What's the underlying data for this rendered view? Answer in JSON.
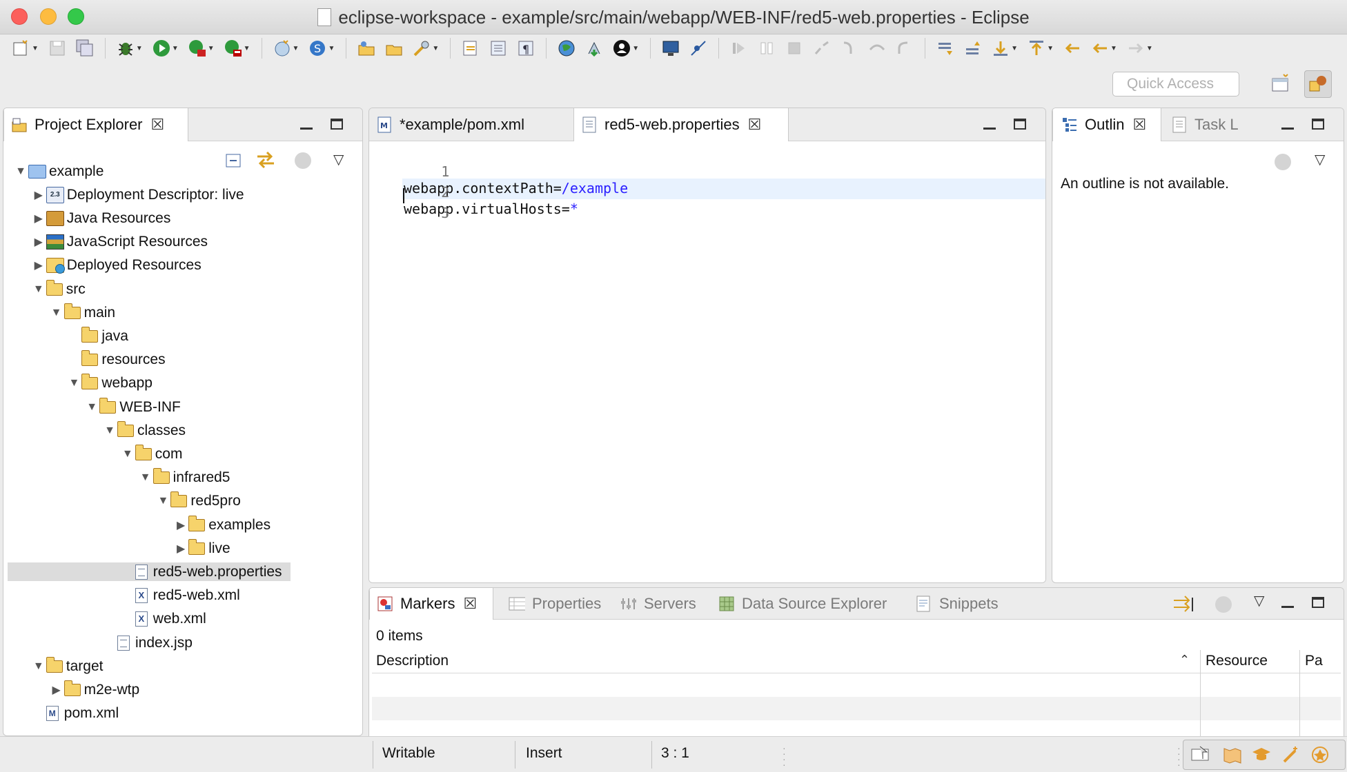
{
  "window": {
    "title": "eclipse-workspace - example/src/main/webapp/WEB-INF/red5-web.properties - Eclipse"
  },
  "toolbar": {
    "quick_access_placeholder": "Quick Access",
    "icons": [
      "new-wizard-icon",
      "save-icon",
      "save-all-icon",
      "debug-icon",
      "run-icon",
      "run-last-icon",
      "external-tools-icon",
      "new-server-icon",
      "new-java-project-icon",
      "open-type-icon",
      "open-task-icon",
      "search-icon",
      "toggle-mark-occurrences-icon",
      "show-whitespace-icon",
      "web-browser-icon",
      "deploy-icon",
      "user-icon",
      "console-icon",
      "skip-breakpoints-icon",
      "resume-icon",
      "suspend-icon",
      "terminate-icon",
      "disconnect-icon",
      "step-into-icon",
      "step-over-icon",
      "step-return-icon",
      "next-annotation-icon",
      "previous-annotation-icon",
      "back-icon",
      "forward-icon"
    ],
    "perspective_icons": [
      "open-perspective-icon",
      "java-ee-perspective-icon"
    ]
  },
  "project_explorer": {
    "tab_label": "Project Explorer",
    "tree": [
      {
        "label": "example",
        "depth": 0,
        "expanded": true,
        "icon": "project-icon"
      },
      {
        "label": "Deployment Descriptor: live",
        "depth": 1,
        "expanded": false,
        "icon": "descriptor-icon"
      },
      {
        "label": "Java Resources",
        "depth": 1,
        "expanded": false,
        "icon": "library-icon"
      },
      {
        "label": "JavaScript Resources",
        "depth": 1,
        "expanded": false,
        "icon": "javascript-icon"
      },
      {
        "label": "Deployed Resources",
        "depth": 1,
        "expanded": false,
        "icon": "deployed-icon"
      },
      {
        "label": "src",
        "depth": 1,
        "expanded": true,
        "icon": "folder-icon"
      },
      {
        "label": "main",
        "depth": 2,
        "expanded": true,
        "icon": "folder-icon"
      },
      {
        "label": "java",
        "depth": 3,
        "expanded": null,
        "icon": "folder-icon"
      },
      {
        "label": "resources",
        "depth": 3,
        "expanded": null,
        "icon": "folder-icon"
      },
      {
        "label": "webapp",
        "depth": 3,
        "expanded": true,
        "icon": "folder-icon"
      },
      {
        "label": "WEB-INF",
        "depth": 4,
        "expanded": true,
        "icon": "folder-icon"
      },
      {
        "label": "classes",
        "depth": 5,
        "expanded": true,
        "icon": "folder-icon"
      },
      {
        "label": "com",
        "depth": 6,
        "expanded": true,
        "icon": "folder-icon"
      },
      {
        "label": "infrared5",
        "depth": 7,
        "expanded": true,
        "icon": "folder-icon"
      },
      {
        "label": "red5pro",
        "depth": 8,
        "expanded": true,
        "icon": "folder-icon"
      },
      {
        "label": "examples",
        "depth": 9,
        "expanded": false,
        "icon": "folder-icon"
      },
      {
        "label": "live",
        "depth": 9,
        "expanded": false,
        "icon": "folder-icon"
      },
      {
        "label": "red5-web.properties",
        "depth": 6,
        "expanded": null,
        "icon": "properties-file-icon",
        "selected": true
      },
      {
        "label": "red5-web.xml",
        "depth": 6,
        "expanded": null,
        "icon": "xml-file-icon"
      },
      {
        "label": "web.xml",
        "depth": 6,
        "expanded": null,
        "icon": "xml-file-icon"
      },
      {
        "label": "index.jsp",
        "depth": 5,
        "expanded": null,
        "icon": "jsp-file-icon"
      },
      {
        "label": "target",
        "depth": 1,
        "expanded": true,
        "icon": "folder-icon"
      },
      {
        "label": "m2e-wtp",
        "depth": 2,
        "expanded": false,
        "icon": "folder-icon"
      },
      {
        "label": "pom.xml",
        "depth": 1,
        "expanded": null,
        "icon": "maven-file-icon"
      }
    ]
  },
  "editor": {
    "tabs": [
      {
        "label": "*example/pom.xml",
        "active": false
      },
      {
        "label": "red5-web.properties",
        "active": true
      }
    ],
    "lines": [
      {
        "number": "1",
        "key": "webapp.contextPath=",
        "value": "/example"
      },
      {
        "number": "2",
        "key": "webapp.virtualHosts=",
        "value": "*"
      },
      {
        "number": "3",
        "key": "",
        "value": ""
      }
    ]
  },
  "outline": {
    "tab_label": "Outlin",
    "tab2_label": "Task L",
    "message": "An outline is not available."
  },
  "bottom_panel": {
    "tabs": [
      {
        "label": "Markers",
        "active": true
      },
      {
        "label": "Properties",
        "active": false
      },
      {
        "label": "Servers",
        "active": false
      },
      {
        "label": "Data Source Explorer",
        "active": false
      },
      {
        "label": "Snippets",
        "active": false
      }
    ],
    "item_count": "0 items",
    "columns": [
      "Description",
      "Resource",
      "Pa"
    ]
  },
  "status_bar": {
    "writable": "Writable",
    "insert_mode": "Insert",
    "position": "3 : 1"
  }
}
